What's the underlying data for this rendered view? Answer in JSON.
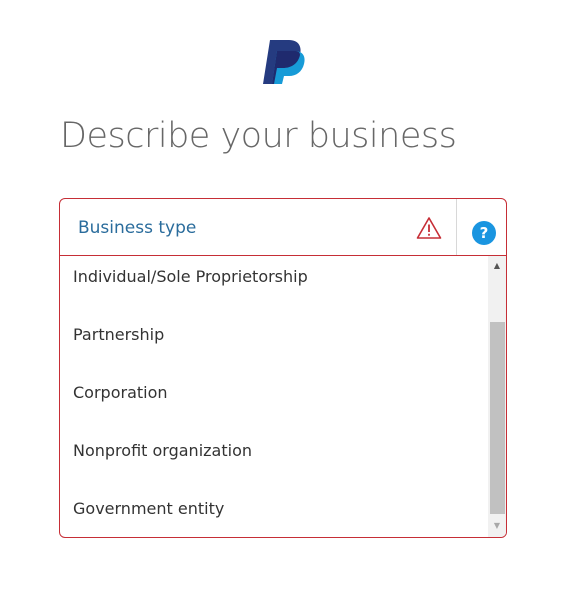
{
  "logo": {
    "icon": "paypal-logo-icon",
    "colors": {
      "dark": "#253b80",
      "light": "#179bd7"
    }
  },
  "page": {
    "title": "Describe your business"
  },
  "business_type": {
    "label": "Business type",
    "error_icon": "warning-icon",
    "help_icon": "help-icon",
    "help_glyph": "?",
    "options": [
      "Individual/Sole Proprietorship",
      "Partnership",
      "Corporation",
      "Nonprofit organization",
      "Government entity"
    ]
  },
  "scrollbar": {
    "up_glyph": "▲",
    "down_glyph": "▼"
  },
  "colors": {
    "error_border": "#c62e36",
    "label": "#2a6c9c",
    "help_bg": "#1a95e0",
    "title": "#676767",
    "option_text": "#333333"
  }
}
